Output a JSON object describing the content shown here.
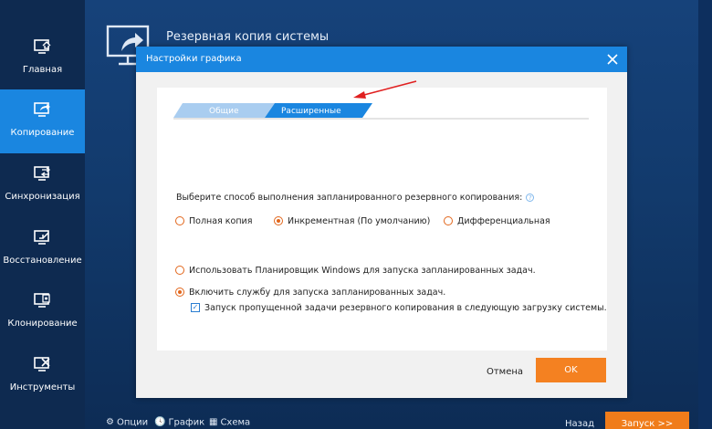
{
  "sidebar": {
    "items": [
      {
        "label": "Главная",
        "icon": "home-icon",
        "active": false
      },
      {
        "label": "Копирование",
        "icon": "backup-icon",
        "active": true
      },
      {
        "label": "Синхронизация",
        "icon": "sync-icon",
        "active": false
      },
      {
        "label": "Восстановление",
        "icon": "restore-icon",
        "active": false
      },
      {
        "label": "Клонирование",
        "icon": "clone-icon",
        "active": false
      },
      {
        "label": "Инструменты",
        "icon": "tools-icon",
        "active": false
      }
    ]
  },
  "main": {
    "title": "Резервная копия системы"
  },
  "footer": {
    "options_label": "Опции",
    "schedule_label": "График",
    "scheme_label": "Схема",
    "back_label": "Назад",
    "start_label": "Запуск >>"
  },
  "dialog": {
    "title": "Настройки графика",
    "tabs": [
      {
        "label": "Общие",
        "active": false
      },
      {
        "label": "Расширенные",
        "active": true
      }
    ],
    "question": "Выберите способ выполнения запланированного резервного копирования:",
    "backup_modes": [
      {
        "label": "Полная копия",
        "checked": false
      },
      {
        "label": "Инкрементная (По умолчанию)",
        "checked": true
      },
      {
        "label": "Дифференциальная",
        "checked": false
      }
    ],
    "scheduler_option": "Использовать Планировщик Windows для запуска запланированных задач.",
    "service_option": "Включить службу для запуска запланированных задач.",
    "missed_task_option": "Запуск пропущенной задачи резервного копирования в следующую загрузку системы.",
    "cancel_label": "Отмена",
    "ok_label": "OK"
  },
  "colors": {
    "accent": "#1a86e0",
    "orange": "#f48121",
    "sidebar": "#0e2a50"
  }
}
